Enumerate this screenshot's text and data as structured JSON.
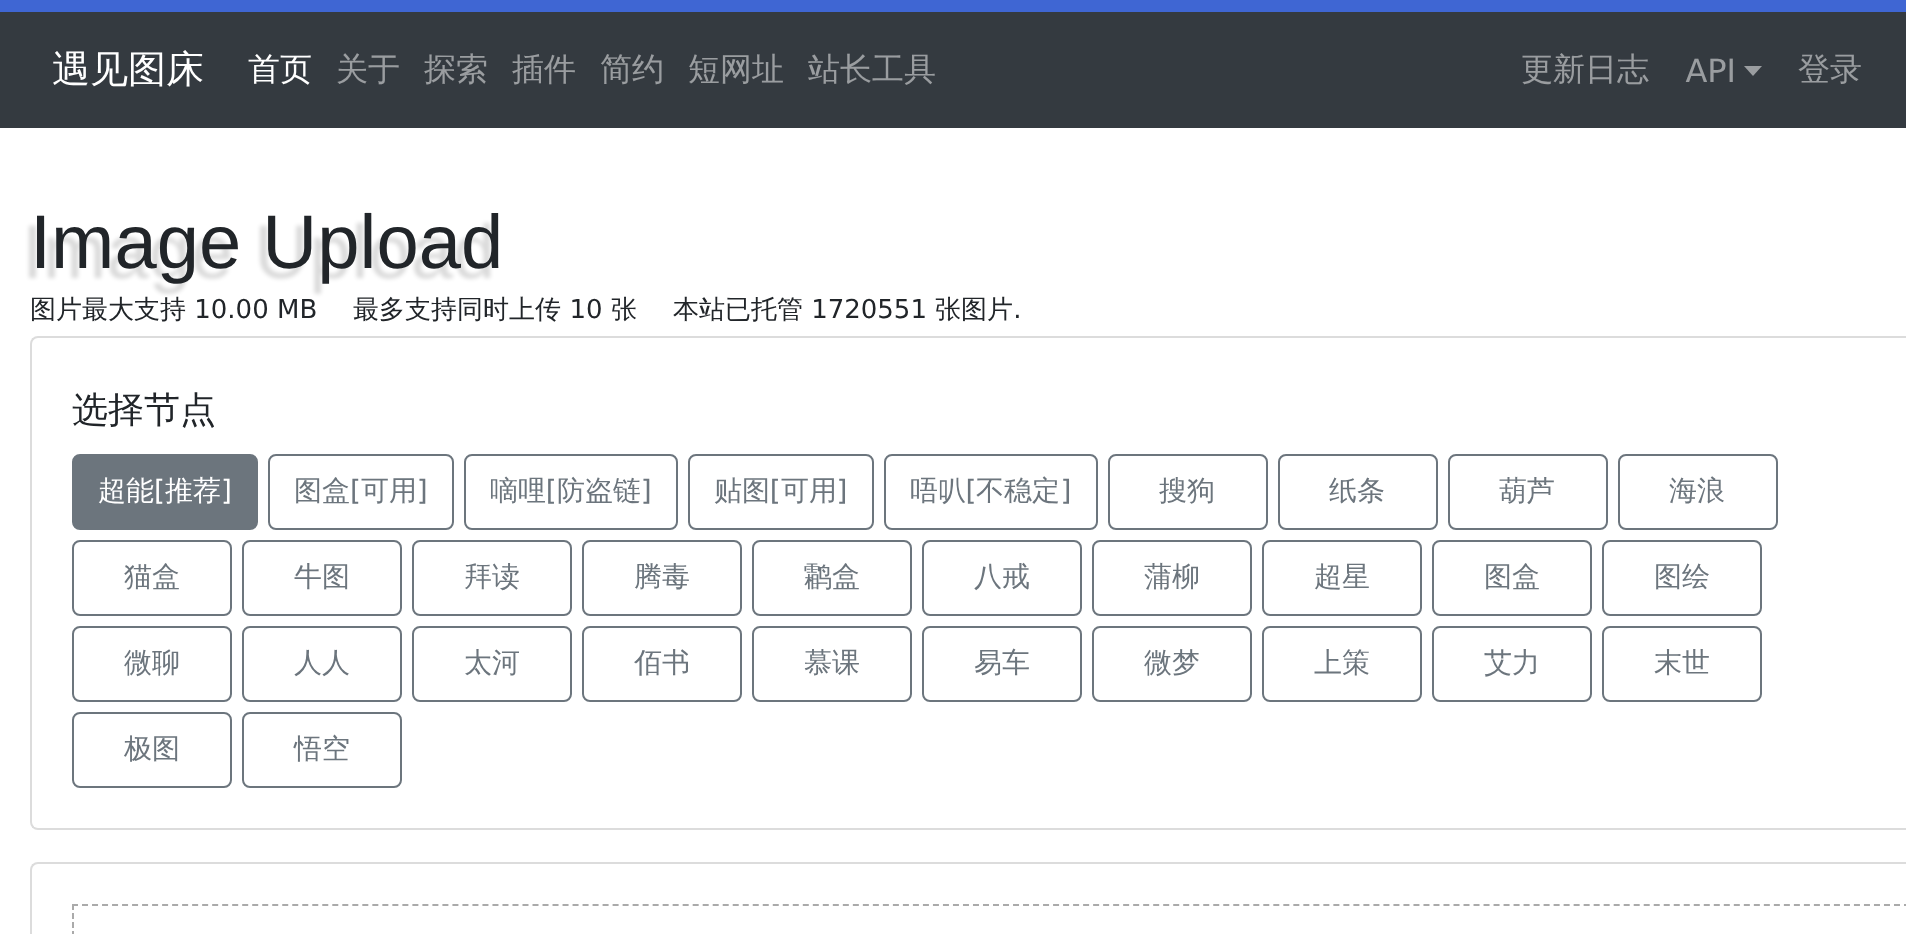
{
  "navbar": {
    "brand": "遇见图床",
    "items": [
      {
        "label": "首页",
        "selected": true
      },
      {
        "label": "关于",
        "selected": false
      },
      {
        "label": "探索",
        "selected": false
      },
      {
        "label": "插件",
        "selected": false
      },
      {
        "label": "简约",
        "selected": false
      },
      {
        "label": "短网址",
        "selected": false
      },
      {
        "label": "站长工具",
        "selected": false
      }
    ],
    "right_items": [
      {
        "label": "更新日志",
        "dropdown": false
      },
      {
        "label": "API",
        "dropdown": true
      },
      {
        "label": "登录",
        "dropdown": false
      }
    ]
  },
  "heading": "Image Upload",
  "info": [
    "图片最大支持 10.00 MB",
    "最多支持同时上传 10 张",
    "本站已托管 1720551 张图片."
  ],
  "node_card": {
    "title": "选择节点",
    "nodes": [
      {
        "label": "超能[推荐]",
        "selected": true
      },
      {
        "label": "图盒[可用]",
        "selected": false
      },
      {
        "label": "嘀哩[防盗链]",
        "selected": false
      },
      {
        "label": "贴图[可用]",
        "selected": false
      },
      {
        "label": "唔叭[不稳定]",
        "selected": false
      },
      {
        "label": "搜狗",
        "selected": false
      },
      {
        "label": "纸条",
        "selected": false
      },
      {
        "label": "葫芦",
        "selected": false
      },
      {
        "label": "海浪",
        "selected": false
      },
      {
        "label": "猫盒",
        "selected": false
      },
      {
        "label": "牛图",
        "selected": false
      },
      {
        "label": "拜读",
        "selected": false
      },
      {
        "label": "腾毒",
        "selected": false
      },
      {
        "label": "鹴盒",
        "selected": false
      },
      {
        "label": "八戒",
        "selected": false
      },
      {
        "label": "蒲柳",
        "selected": false
      },
      {
        "label": "超星",
        "selected": false
      },
      {
        "label": "图盒",
        "selected": false
      },
      {
        "label": "图绘",
        "selected": false
      },
      {
        "label": "微聊",
        "selected": false
      },
      {
        "label": "人人",
        "selected": false
      },
      {
        "label": "太河",
        "selected": false
      },
      {
        "label": "佰书",
        "selected": false
      },
      {
        "label": "慕课",
        "selected": false
      },
      {
        "label": "易车",
        "selected": false
      },
      {
        "label": "微梦",
        "selected": false
      },
      {
        "label": "上策",
        "selected": false
      },
      {
        "label": "艾力",
        "selected": false
      },
      {
        "label": "末世",
        "selected": false
      },
      {
        "label": "极图",
        "selected": false
      },
      {
        "label": "悟空",
        "selected": false
      }
    ]
  }
}
